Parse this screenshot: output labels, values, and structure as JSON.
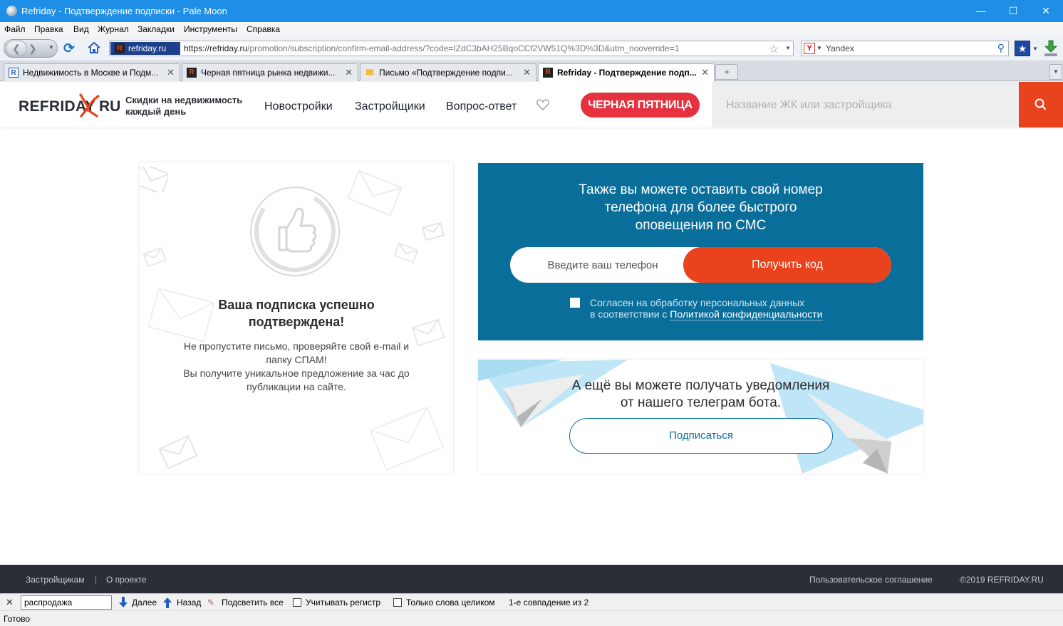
{
  "window": {
    "title": "Refriday - Подтверждение подписки - Pale Moon",
    "controls": [
      "—",
      "☐",
      "✕"
    ]
  },
  "menu": [
    "Файл",
    "Правка",
    "Вид",
    "Журнал",
    "Закладки",
    "Инструменты",
    "Справка"
  ],
  "navbar": {
    "site_identity": "refriday.ru",
    "url_host": "https://refriday.ru",
    "url_path": "/promotion/subscription/confirm-email-address/?code=IZdC3bAH25BqoCCf2VW51Q%3D%3D&utm_nooverride=1",
    "search_engine": "Yandex"
  },
  "tabs": [
    {
      "label": "Недвижимость в Москве и Подм...",
      "favicon": "R",
      "favicon_color": "#1e5ab4"
    },
    {
      "label": "Черная пятница рынка недвижи...",
      "favicon": "R",
      "favicon_color": "#e8431c"
    },
    {
      "label": "Письмо «Подтверждение подпи...",
      "favicon": "✉",
      "favicon_color": "#f2a900"
    },
    {
      "label": "Refriday - Подтверждение подп...",
      "favicon": "R",
      "favicon_color": "#e8431c",
      "active": true
    }
  ],
  "header": {
    "logo_left": "REFRIDAY",
    "logo_right": "RU",
    "tagline_line1": "Скидки на недвижимость",
    "tagline_line2": "каждый день",
    "nav": [
      "Новостройки",
      "Застройщики",
      "Вопрос-ответ"
    ],
    "black_friday": "ЧЕРНАЯ ПЯТНИЦА",
    "search_placeholder": "Название ЖК или застройщика"
  },
  "confirm_card": {
    "title_line1": "Ваша подписка успешно",
    "title_line2": "подтверждена!",
    "text_line1": "Не пропустите письмо, проверяйте свой e-mail и",
    "text_line2": "папку СПАМ!",
    "text_line3": "Вы получите уникальное предложение за час до",
    "text_line4": "публикации на сайте."
  },
  "sms_card": {
    "title_line1": "Также вы можете оставить свой номер",
    "title_line2": "телефона для более быстрого",
    "title_line3": "оповещения по СМС",
    "phone_placeholder": "Введите ваш телефон",
    "get_code": "Получить код",
    "agree_line1": "Согласен на обработку персональных данных",
    "agree_line2_prefix": "в соответствии с ",
    "agree_link": "Политикой конфиденциальности"
  },
  "telegram_card": {
    "title_line1": "А ещё вы можете получать уведомления",
    "title_line2": "от нашего телеграм бота.",
    "subscribe": "Подписаться"
  },
  "footer": {
    "developers": "Застройщикам",
    "separator": "|",
    "about": "О проекте",
    "terms": "Пользовательское соглашение",
    "copyright": "©2019 REFRIDAY.RU"
  },
  "findbar": {
    "query": "распродажа",
    "next": "Далее",
    "prev": "Назад",
    "highlight": "Подсветить все",
    "match_case": "Учитывать регистр",
    "whole_words": "Только слова целиком",
    "status": "1-е совпадение из 2"
  },
  "statusbar": {
    "text": "Готово"
  },
  "colors": {
    "accent": "#e8431c",
    "blue": "#0a6e9b",
    "red_button": "#e6323e",
    "footer": "#2b2e36",
    "titlebar": "#1e8ee6"
  }
}
